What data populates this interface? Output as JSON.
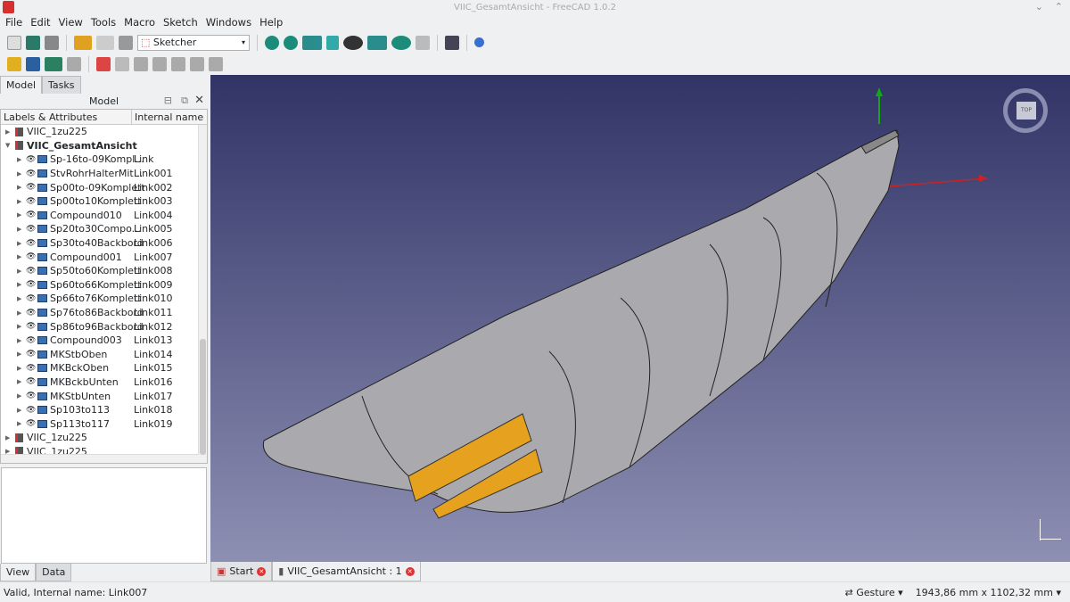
{
  "window": {
    "title": "VIIC_GesamtAnsicht - FreeCAD 1.0.2"
  },
  "menu": [
    "File",
    "Edit",
    "View",
    "Tools",
    "Macro",
    "Sketch",
    "Windows",
    "Help"
  ],
  "toolbar": {
    "workbench": "Sketcher"
  },
  "left": {
    "tabs": [
      "Model",
      "Tasks"
    ],
    "panel_title": "Model",
    "columns": [
      "Labels & Attributes",
      "Internal name"
    ],
    "tree": [
      {
        "label": "VIIC_1zu225",
        "internal": "",
        "level": 0,
        "expanded": false,
        "bold": false
      },
      {
        "label": "VIIC_GesamtAnsicht",
        "internal": "",
        "level": 0,
        "expanded": true,
        "bold": true
      },
      {
        "label": "Sp-16to-09Kompl...",
        "internal": "Link",
        "level": 1
      },
      {
        "label": "StvRohrHalterMit...",
        "internal": "Link001",
        "level": 1
      },
      {
        "label": "Sp00to-09Komplett",
        "internal": "Link002",
        "level": 1
      },
      {
        "label": "Sp00to10Komplett",
        "internal": "Link003",
        "level": 1
      },
      {
        "label": "Compound010",
        "internal": "Link004",
        "level": 1
      },
      {
        "label": "Sp20to30Compo...",
        "internal": "Link005",
        "level": 1
      },
      {
        "label": "Sp30to40Backbord",
        "internal": "Link006",
        "level": 1
      },
      {
        "label": "Compound001",
        "internal": "Link007",
        "level": 1
      },
      {
        "label": "Sp50to60Komplett",
        "internal": "Link008",
        "level": 1
      },
      {
        "label": "Sp60to66Komplett",
        "internal": "Link009",
        "level": 1
      },
      {
        "label": "Sp66to76Komplett",
        "internal": "Link010",
        "level": 1
      },
      {
        "label": "Sp76to86Backbord",
        "internal": "Link011",
        "level": 1
      },
      {
        "label": "Sp86to96Backbord",
        "internal": "Link012",
        "level": 1
      },
      {
        "label": "Compound003",
        "internal": "Link013",
        "level": 1
      },
      {
        "label": "MKStbOben",
        "internal": "Link014",
        "level": 1
      },
      {
        "label": "MKBckOben",
        "internal": "Link015",
        "level": 1
      },
      {
        "label": "MKBckbUnten",
        "internal": "Link016",
        "level": 1
      },
      {
        "label": "MKStbUnten",
        "internal": "Link017",
        "level": 1
      },
      {
        "label": "Sp103to113",
        "internal": "Link018",
        "level": 1
      },
      {
        "label": "Sp113to117",
        "internal": "Link019",
        "level": 1
      },
      {
        "label": "VIIC_1zu225",
        "internal": "",
        "level": 0,
        "expanded": false,
        "bold": false
      },
      {
        "label": "VIIC_1zu225",
        "internal": "",
        "level": 0,
        "expanded": false,
        "bold": false
      }
    ],
    "prop_tabs": [
      "View",
      "Data"
    ]
  },
  "doc_tabs": [
    "Start",
    "VIIC_GesamtAnsicht : 1"
  ],
  "navcube": {
    "face": "TOP"
  },
  "status": {
    "message": "Valid, Internal name: Link007",
    "nav_style": "Gesture",
    "dimensions": "1943,86 mm x 1102,32 mm"
  },
  "colors": {
    "accent_panel": "#e6a21f",
    "hull": "#a9a9ae"
  }
}
